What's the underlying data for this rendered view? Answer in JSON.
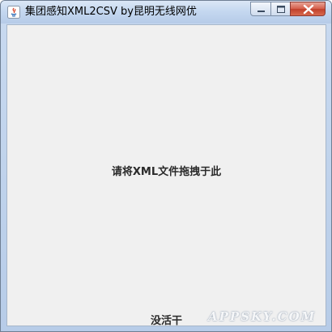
{
  "window": {
    "title": "集团感知XML2CSV by昆明无线网优",
    "controls": {
      "minimize": "minimize-icon",
      "maximize": "maximize-icon",
      "close": "close-icon"
    }
  },
  "main": {
    "drop_hint": "请将XML文件拖拽于此",
    "status": "没活干"
  },
  "watermark": {
    "text": "APPSKY.COM"
  },
  "colors": {
    "client_background": "#f0f0f0",
    "titlebar": "#c5d8f0",
    "close_button": "#c1402b"
  }
}
